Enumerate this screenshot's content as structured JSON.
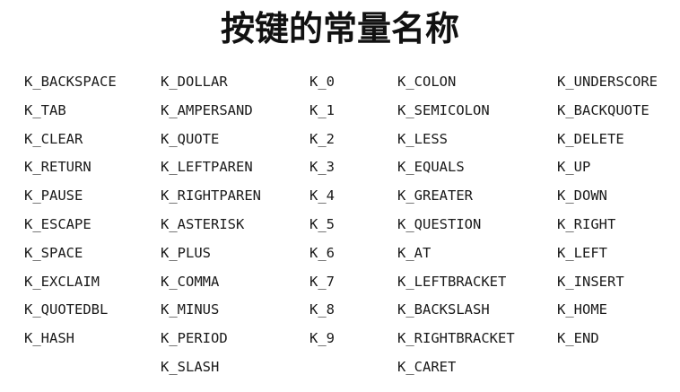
{
  "title": "按键的常量名称",
  "columns": [
    [
      "K_BACKSPACE",
      "K_TAB",
      "K_CLEAR",
      "K_RETURN",
      "K_PAUSE",
      "K_ESCAPE",
      "K_SPACE",
      "K_EXCLAIM",
      "K_QUOTEDBL",
      "K_HASH"
    ],
    [
      "K_DOLLAR",
      "K_AMPERSAND",
      "K_QUOTE",
      "K_LEFTPAREN",
      "K_RIGHTPAREN",
      "K_ASTERISK",
      "K_PLUS",
      "K_COMMA",
      "K_MINUS",
      "K_PERIOD",
      "K_SLASH"
    ],
    [
      "K_0",
      "K_1",
      "K_2",
      "K_3",
      "K_4",
      "K_5",
      "K_6",
      "K_7",
      "K_8",
      "K_9"
    ],
    [
      "K_COLON",
      "K_SEMICOLON",
      "K_LESS",
      "K_EQUALS",
      "K_GREATER",
      "K_QUESTION",
      "K_AT",
      "K_LEFTBRACKET",
      "K_BACKSLASH",
      "K_RIGHTBRACKET",
      "K_CARET"
    ],
    [
      "K_UNDERSCORE",
      "K_BACKQUOTE",
      "K_DELETE",
      "K_UP",
      "K_DOWN",
      "K_RIGHT",
      "K_LEFT",
      "K_INSERT",
      "K_HOME",
      "K_END"
    ]
  ]
}
